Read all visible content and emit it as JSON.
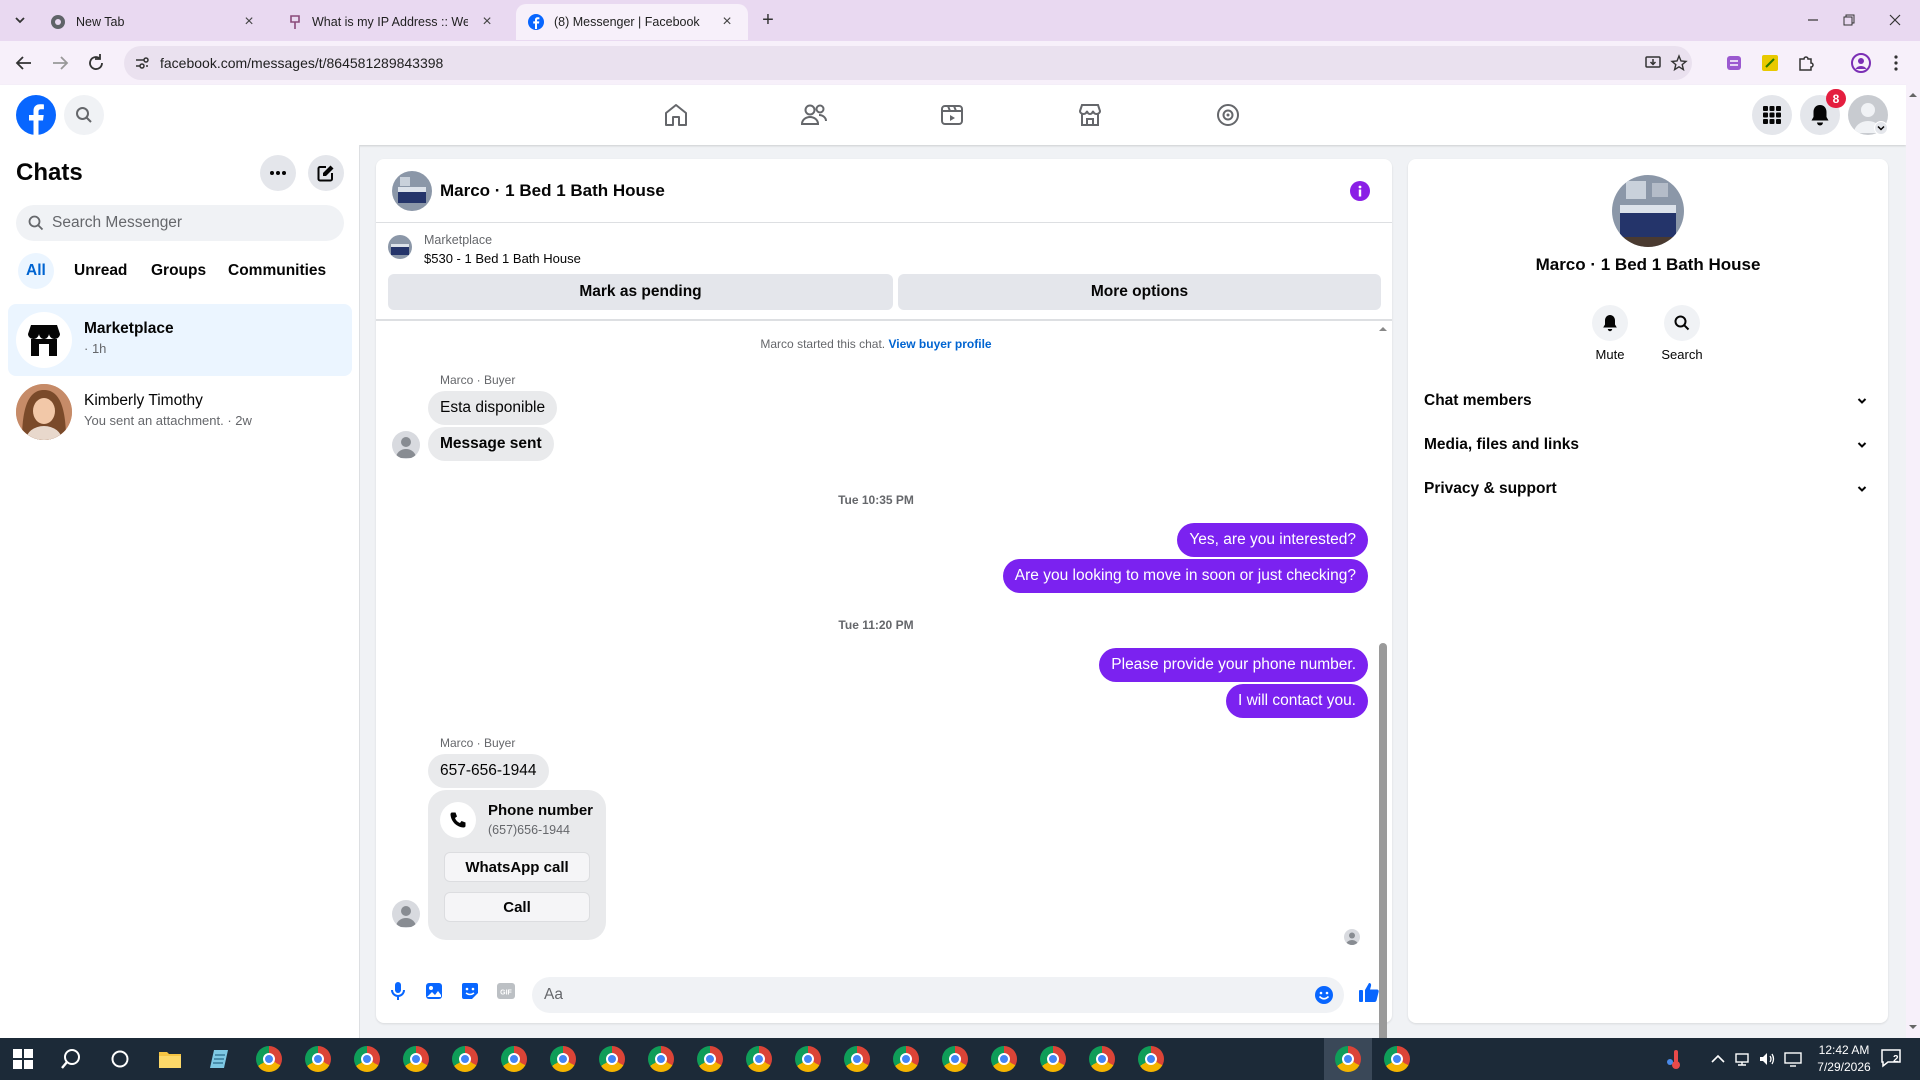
{
  "browser": {
    "tabs": [
      {
        "title": "New Tab",
        "active": false
      },
      {
        "title": "What is my IP Address :: WebBrow",
        "active": false
      },
      {
        "title": "(8) Messenger | Facebook",
        "active": true
      }
    ],
    "url": "facebook.com/messages/t/864581289843398"
  },
  "fb_header": {
    "notification_count": "8"
  },
  "left_panel": {
    "title": "Chats",
    "search_placeholder": "Search Messenger",
    "filters": [
      "All",
      "Unread",
      "Groups",
      "Communities"
    ],
    "active_filter": "All",
    "chats": [
      {
        "name": "Marketplace",
        "preview": "· 1h"
      },
      {
        "name": "Kimberly Timothy",
        "preview": "You sent an attachment. · 2w"
      }
    ]
  },
  "conversation": {
    "title": "Marco · 1 Bed 1 Bath House",
    "listing_source": "Marketplace",
    "listing_title": "$530 - 1 Bed 1 Bath House",
    "mark_pending_label": "Mark as pending",
    "more_options_label": "More options",
    "started_text": "Marco started this chat.",
    "view_profile_link": "View buyer profile",
    "sender_label": "Marco · Buyer",
    "incoming_1": "Esta disponible",
    "incoming_2": "Message sent",
    "time_1": "Tue 10:35 PM",
    "outgoing_1": "Yes, are you interested?",
    "outgoing_2": "Are you looking to move in soon or just checking?",
    "time_2": "Tue 11:20 PM",
    "outgoing_3": "Please provide your phone number.",
    "outgoing_4": "I will contact you.",
    "incoming_3": "657-656-1944",
    "phone_card_title": "Phone number",
    "phone_card_value": "(657)656-1944",
    "whatsapp_label": "WhatsApp call",
    "call_label": "Call",
    "composer_placeholder": "Aa"
  },
  "right_panel": {
    "name": "Marco · 1 Bed 1 Bath House",
    "mute_label": "Mute",
    "search_label": "Search",
    "sections": [
      "Chat members",
      "Media, files and links",
      "Privacy & support"
    ]
  },
  "taskbar": {
    "time": "12:42 AM",
    "date": "7/29/2026",
    "notification_count": "2"
  },
  "colors": {
    "facebook_blue": "#0866ff",
    "outgoing_bubble": "#7b22f0",
    "notification_red": "#e41e3f"
  }
}
